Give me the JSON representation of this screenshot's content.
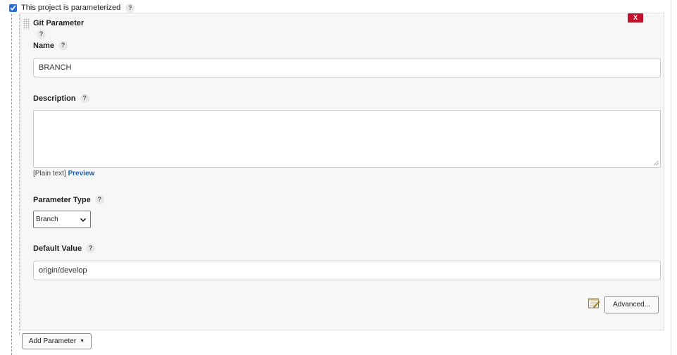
{
  "header": {
    "checkbox_label": "This project is parameterized",
    "help": "?"
  },
  "parameter": {
    "title": "Git Parameter",
    "title_help": "?",
    "delete_label": "X",
    "name": {
      "label": "Name",
      "help": "?",
      "value": "BRANCH"
    },
    "description": {
      "label": "Description",
      "help": "?",
      "value": "",
      "plain_text": "[Plain text]",
      "preview": "Preview"
    },
    "parameter_type": {
      "label": "Parameter Type",
      "help": "?",
      "selected": "Branch"
    },
    "default_value": {
      "label": "Default Value",
      "help": "?",
      "value": "origin/develop"
    },
    "advanced_label": "Advanced..."
  },
  "footer": {
    "add_parameter_label": "Add Parameter",
    "caret": "▼"
  },
  "colors": {
    "delete_red": "#c4122a",
    "link_blue": "#1d5ea8",
    "panel_bg": "#f7f7f7",
    "checkbox_blue": "#2a6ed8"
  },
  "icons": {
    "help": "question-mark",
    "drag": "drag-handle",
    "notepad": "notepad-pencil",
    "select_arrow": "chevron-down"
  }
}
